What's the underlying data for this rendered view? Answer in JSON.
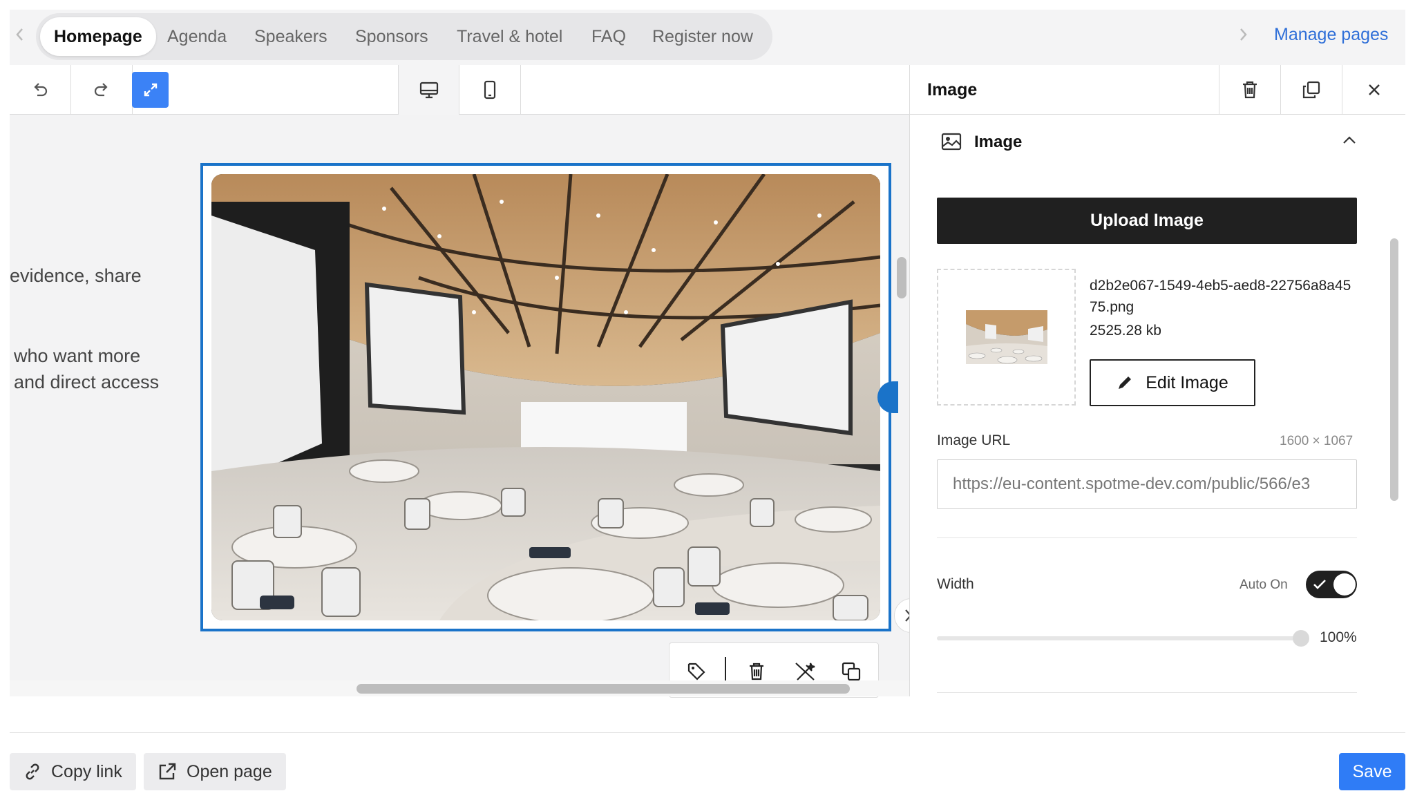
{
  "nav": {
    "tabs": [
      {
        "label": "Homepage",
        "active": true
      },
      {
        "label": "Agenda"
      },
      {
        "label": "Speakers"
      },
      {
        "label": "Sponsors"
      },
      {
        "label": "Travel & hotel"
      },
      {
        "label": "FAQ"
      },
      {
        "label": "Register now"
      }
    ],
    "manage_pages": "Manage pages"
  },
  "toolbar": {
    "undo_icon": "undo-icon",
    "redo_icon": "redo-icon",
    "fullscreen_icon": "expand-icon",
    "desktop_icon": "desktop-icon",
    "mobile_icon": "mobile-icon",
    "accent_color": "#3b82f6"
  },
  "canvas": {
    "text_lines": [
      "evidence, share",
      "who want more",
      "and direct access"
    ],
    "selection_color": "#1a73c9",
    "image_toolbar_icons": [
      "tag-icon",
      "trash-icon",
      "magic-wand-off-icon",
      "duplicate-icon"
    ]
  },
  "panel": {
    "title": "Image",
    "header_icons": [
      "trash-icon",
      "duplicate-icon",
      "close-icon"
    ],
    "section_title": "Image",
    "upload_label": "Upload Image",
    "file_name": "d2b2e067-1549-4eb5-aed8-22756a8a4575.png",
    "file_size": "2525.28 kb",
    "edit_label": "Edit Image",
    "url_label": "Image URL",
    "dimensions": "1600 × 1067",
    "url_value": "https://eu-content.spotme-dev.com/public/566/e3",
    "width_label": "Width",
    "auto_label": "Auto On",
    "auto_on": true,
    "width_value": "100%",
    "width_fraction": 1.0
  },
  "footer": {
    "copy_link": "Copy link",
    "open_page": "Open page",
    "save": "Save",
    "save_color": "#2f7cf6"
  }
}
